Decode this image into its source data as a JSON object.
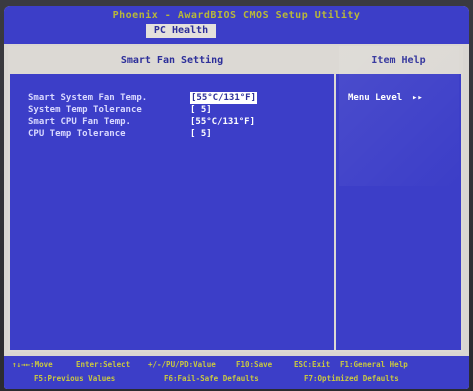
{
  "bios": {
    "title": "Phoenix - AwardBIOS CMOS Setup Utility",
    "active_tab": "PC Health"
  },
  "panel": {
    "header_main": "Smart Fan Setting",
    "header_help": "Item Help",
    "settings": [
      {
        "label": "Smart System Fan Temp.",
        "value": "[55°C/131°F]",
        "selected": true
      },
      {
        "label": "System Temp Tolerance",
        "value": "[ 5]",
        "selected": false
      },
      {
        "label": "Smart CPU Fan Temp.",
        "value": "[55°C/131°F]",
        "selected": false
      },
      {
        "label": "CPU Temp Tolerance",
        "value": "[ 5]",
        "selected": false
      }
    ],
    "help": {
      "menu_level_label": "Menu Level",
      "menu_level_arrow": "▸▸"
    }
  },
  "footer": {
    "line1": [
      "↑↓→←:Move",
      "Enter:Select",
      "+/-/PU/PD:Value",
      "F10:Save",
      "ESC:Exit",
      "F1:General Help"
    ],
    "line2": [
      "F5:Previous Values",
      "F6:Fail-Safe Defaults",
      "F7:Optimized Defaults"
    ]
  }
}
